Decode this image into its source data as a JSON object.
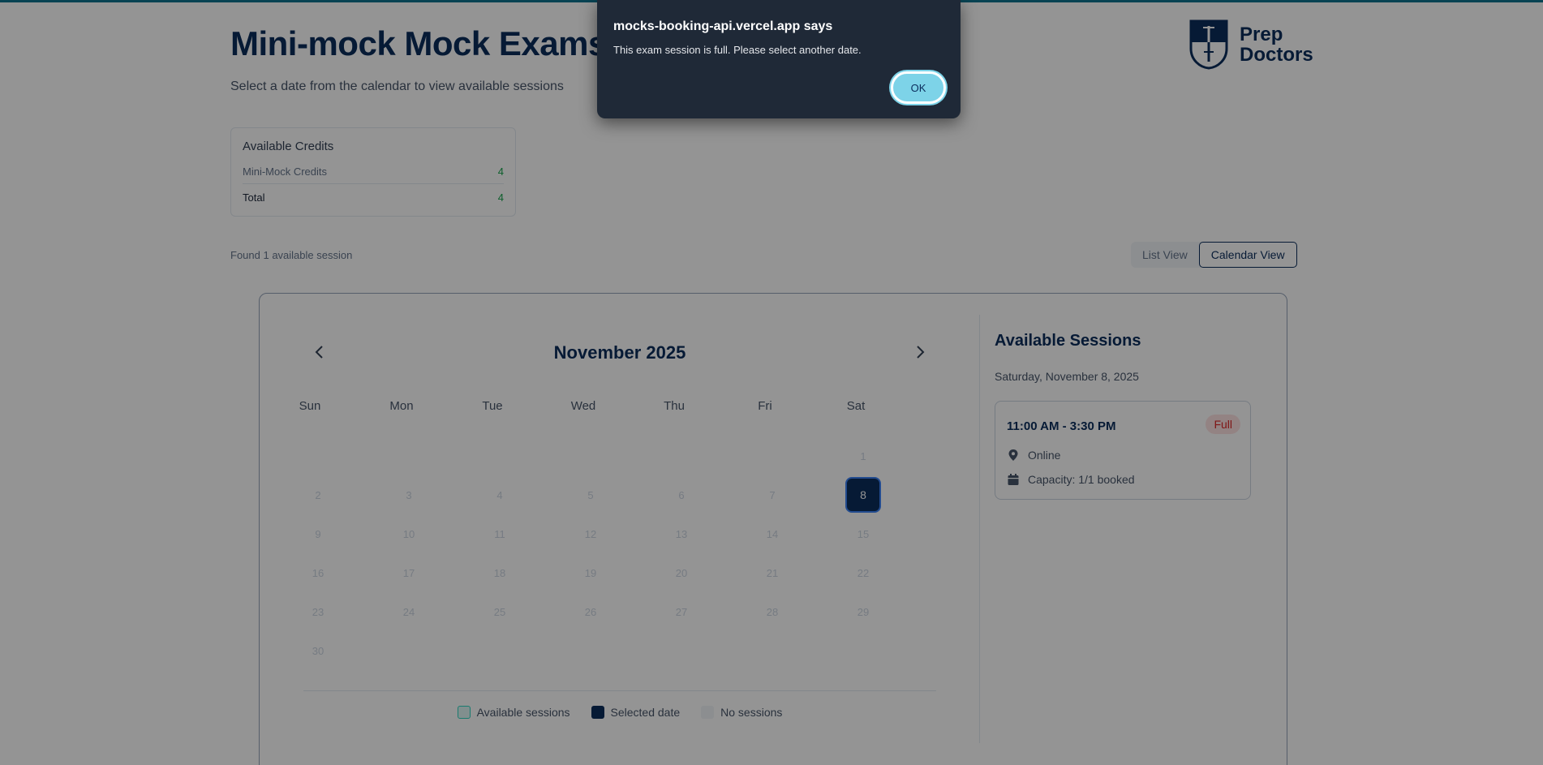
{
  "header": {
    "title": "Mini-mock Mock Exams",
    "subtitle": "Select a date from the calendar to view available sessions",
    "logo_line1": "Prep",
    "logo_line2": "Doctors"
  },
  "credits": {
    "title": "Available Credits",
    "rows": [
      {
        "label": "Mini-Mock Credits",
        "value": "4"
      },
      {
        "label": "Total",
        "value": "4"
      }
    ]
  },
  "results": {
    "found_text": "Found 1 available session"
  },
  "view_toggle": {
    "list_label": "List View",
    "calendar_label": "Calendar View",
    "active": "calendar"
  },
  "calendar": {
    "month_label": "November 2025",
    "weekdays": [
      "Sun",
      "Mon",
      "Tue",
      "Wed",
      "Thu",
      "Fri",
      "Sat"
    ],
    "days": [
      "1",
      "2",
      "3",
      "4",
      "5",
      "6",
      "7",
      "8",
      "9",
      "10",
      "11",
      "12",
      "13",
      "14",
      "15",
      "16",
      "17",
      "18",
      "19",
      "20",
      "21",
      "22",
      "23",
      "24",
      "25",
      "26",
      "27",
      "28",
      "29",
      "30"
    ],
    "first_weekday_index": 6,
    "selected_day": "8",
    "legend": {
      "available": "Available sessions",
      "selected": "Selected date",
      "none": "No sessions"
    }
  },
  "sessions": {
    "title": "Available Sessions",
    "date_label": "Saturday, November 8, 2025",
    "items": [
      {
        "time": "11:00 AM - 3:30 PM",
        "status": "Full",
        "location": "Online",
        "capacity": "Capacity: 1/1 booked"
      }
    ]
  },
  "dialog": {
    "title": "mocks-booking-api.vercel.app says",
    "message": "This exam session is full. Please select another date.",
    "ok_label": "OK"
  },
  "colors": {
    "brand": "#0b2d5c",
    "ok_button": "#7dd3e8",
    "credit_value": "#16a34a",
    "full_badge": "#dc2626"
  },
  "icons": {
    "prev": "chevron-left-icon",
    "next": "chevron-right-icon",
    "location": "location-pin-icon",
    "capacity": "calendar-icon"
  }
}
